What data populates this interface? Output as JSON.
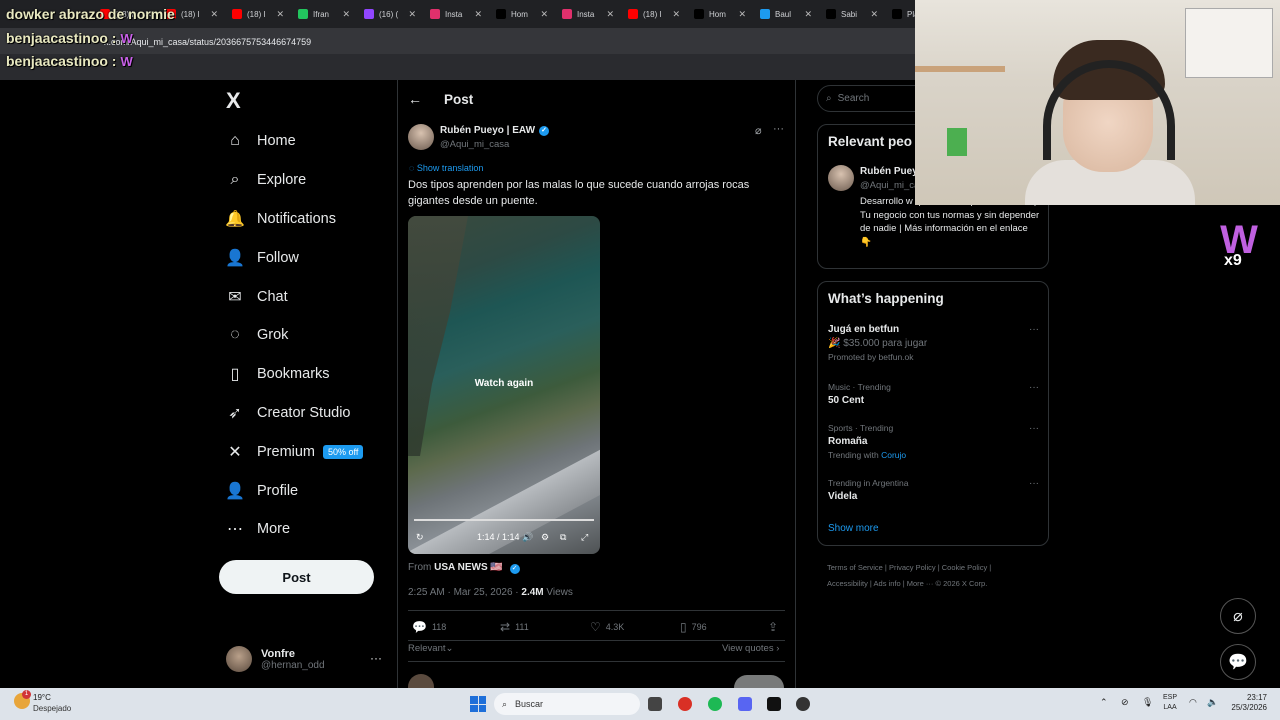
{
  "browser": {
    "tabs": [
      {
        "label": "(18) I",
        "color": "#ff0000"
      },
      {
        "label": "(18) I",
        "color": "#ff0000"
      },
      {
        "label": "(18) I",
        "color": "#ff0000"
      },
      {
        "label": "Ifran",
        "color": "#22c55e"
      },
      {
        "label": "(16) (",
        "color": "#9146ff"
      },
      {
        "label": "Insta",
        "color": "#e1306c"
      },
      {
        "label": "Hom",
        "color": "#000000"
      },
      {
        "label": "Insta",
        "color": "#e1306c"
      },
      {
        "label": "(18) I",
        "color": "#ff0000"
      },
      {
        "label": "Hom",
        "color": "#000000"
      },
      {
        "label": "Baul",
        "color": "#1d9bf0"
      },
      {
        "label": "Sabi",
        "color": "#000000"
      },
      {
        "label": "Plaq",
        "color": "#000000"
      }
    ],
    "url": "x.com/Aqui_mi_casa/status/2036675753446674759"
  },
  "stream_overlay": {
    "title": "dowker abrazo de normie",
    "chat": [
      {
        "user": "benjaacastinoo :",
        "emote": "W"
      },
      {
        "user": "benjaacastinoo :",
        "emote": "W"
      }
    ],
    "logo_text": "W",
    "logo_sub": "x9"
  },
  "sidebar": {
    "logo": "X",
    "items": [
      {
        "label": "Home",
        "icon": "home-icon",
        "glyph": "⌂"
      },
      {
        "label": "Explore",
        "icon": "search-icon",
        "glyph": "⌕"
      },
      {
        "label": "Notifications",
        "icon": "bell-icon",
        "glyph": "🔔"
      },
      {
        "label": "Follow",
        "icon": "add-person-icon",
        "glyph": "👤"
      },
      {
        "label": "Chat",
        "icon": "mail-icon",
        "glyph": "✉"
      },
      {
        "label": "Grok",
        "icon": "grok-icon",
        "glyph": "◌"
      },
      {
        "label": "Bookmarks",
        "icon": "bookmark-icon",
        "glyph": "▯"
      },
      {
        "label": "Creator Studio",
        "icon": "rocket-icon",
        "glyph": "➶"
      },
      {
        "label": "Premium",
        "icon": "x-icon",
        "glyph": "✕"
      },
      {
        "label": "Profile",
        "icon": "person-icon",
        "glyph": "👤"
      },
      {
        "label": "More",
        "icon": "more-circle-icon",
        "glyph": "⋯"
      }
    ],
    "premium_badge": "50% off",
    "post_button": "Post",
    "account": {
      "name": "Vonfre",
      "handle": "@hernan_odd",
      "more": "···"
    }
  },
  "post": {
    "header_title": "Post",
    "author_name": "Rubén Pueyo | EAW",
    "author_handle": "@Aqui_mi_casa",
    "show_translation": "Show translation",
    "text": "Dos tipos aprenden por las malas lo que sucede cuando arrojas rocas gigantes desde un puente.",
    "video": {
      "overlay": "Watch again",
      "time": "1:14 / 1:14",
      "progress": 1.0
    },
    "from_label": "From",
    "from_source": "USA NEWS 🇺🇸",
    "timestamp": "2:25 AM · Mar 25, 2026 · ",
    "views_count": "2.4M",
    "views_label": " Views",
    "stats": {
      "replies": "118",
      "reposts": "111",
      "likes": "4.3K",
      "bookmarks": "796"
    },
    "relevant_label": "Relevant⌄",
    "view_quotes": "View quotes ›"
  },
  "right": {
    "search_placeholder": "Search",
    "relevant_people_title": "Relevant peo",
    "rp_name": "Rubén Pueyo",
    "rp_handle": "@Aqui_mi_ca",
    "rp_bio": "Desarrollo w que te van a permitir crecer | Tu negocio con tus normas y sin depender de nadie | Más información en el enlace 👇",
    "whats_happening_title": "What’s happening",
    "trends": [
      {
        "sub": "",
        "main": "Jugá en betfun",
        "extra": "🎉 $35.000 para jugar",
        "extra2": "Promoted by betfun.ok"
      },
      {
        "sub": "Music · Trending",
        "main": "50 Cent",
        "extra": "",
        "extra2": ""
      },
      {
        "sub": "Sports · Trending",
        "main": "Romaña",
        "extra": "Trending with ",
        "extra_link": "Corujo",
        "extra2": ""
      },
      {
        "sub": "Trending in Argentina",
        "main": "Videla",
        "extra": "",
        "extra2": ""
      }
    ],
    "show_more": "Show more",
    "footer_line1": "Terms of Service  |  Privacy Policy  |  Cookie Policy  |",
    "footer_line2": "Accessibility  |  Ads info  |  More ···  © 2026 X Corp."
  },
  "taskbar": {
    "temperature": "19°C",
    "condition": "Despejado",
    "search": "Buscar",
    "lang": "ESP",
    "lang_sub": "LAA",
    "time": "23:17",
    "date": "25/3/2026"
  }
}
